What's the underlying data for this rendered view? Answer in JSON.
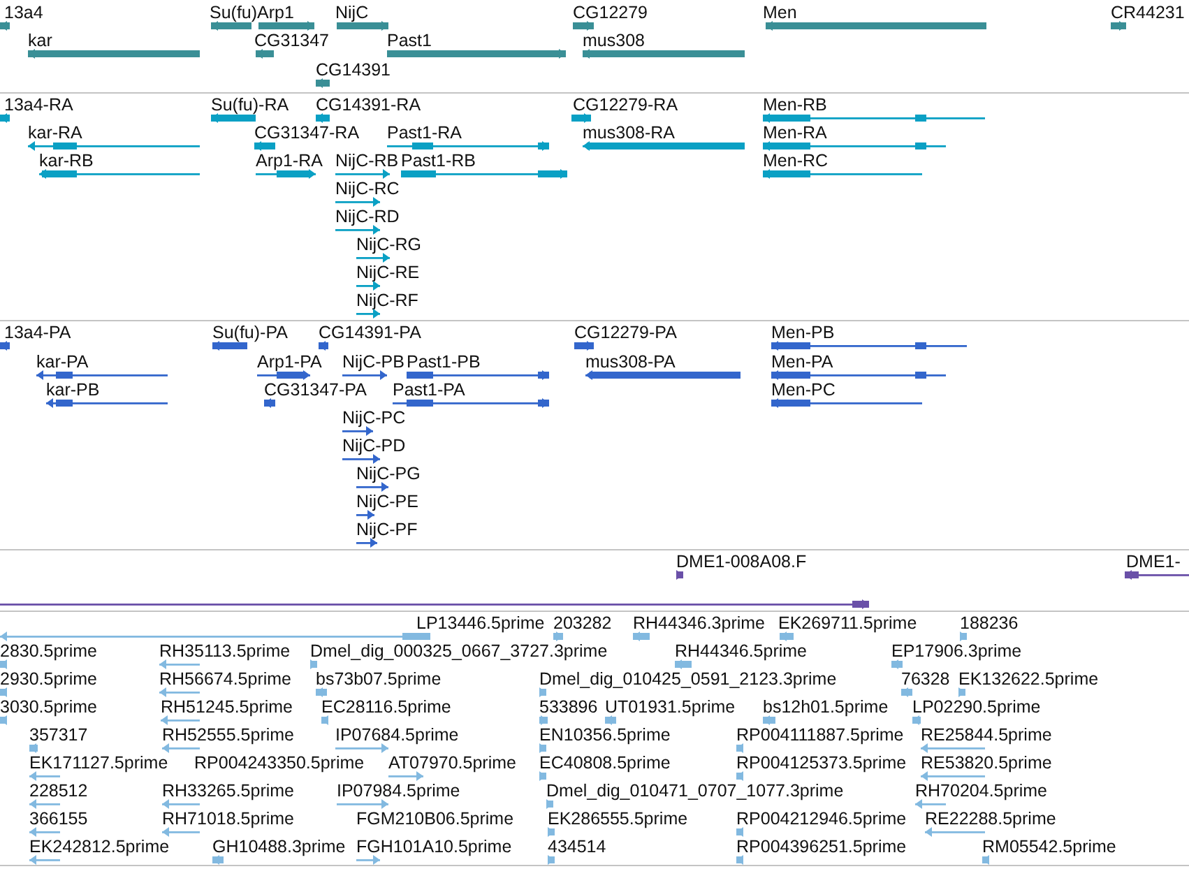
{
  "tracks": [
    {
      "kind": "gene",
      "features": [
        {
          "label": "13a4",
          "kind": "reverse"
        },
        {
          "label": "Su(fu)",
          "kind": "reverse"
        },
        {
          "label": "Arp1",
          "kind": "forward"
        },
        {
          "label": "NijC",
          "kind": "forward"
        },
        {
          "label": "CG12279",
          "kind": "forward"
        },
        {
          "label": "Men",
          "kind": "reverse"
        },
        {
          "label": "CR44231",
          "kind": "forward"
        },
        {
          "label": "kar",
          "kind": "reverse"
        },
        {
          "label": "CG31347",
          "kind": "reverse"
        },
        {
          "label": "Past1",
          "kind": "forward"
        },
        {
          "label": "mus308",
          "kind": "reverse"
        },
        {
          "label": "CG14391",
          "kind": "reverse"
        }
      ]
    },
    {
      "kind": "transcript",
      "features": [
        {
          "label": "13a4-RA",
          "kind": "reverse"
        },
        {
          "label": "Su(fu)-RA",
          "kind": "reverse"
        },
        {
          "label": "CG14391-RA",
          "kind": "reverse"
        },
        {
          "label": "CG12279-RA",
          "kind": "forward"
        },
        {
          "label": "Men-RB",
          "kind": "reverse"
        },
        {
          "label": "kar-RA",
          "kind": "reverse"
        },
        {
          "label": "CG31347-RA",
          "kind": "reverse"
        },
        {
          "label": "Past1-RA",
          "kind": "forward"
        },
        {
          "label": "mus308-RA",
          "kind": "reverse"
        },
        {
          "label": "Men-RA",
          "kind": "reverse"
        },
        {
          "label": "kar-RB",
          "kind": "reverse"
        },
        {
          "label": "Arp1-RA",
          "kind": "forward"
        },
        {
          "label": "NijC-RB",
          "kind": "forward"
        },
        {
          "label": "Past1-RB",
          "kind": "forward"
        },
        {
          "label": "Men-RC",
          "kind": "reverse"
        },
        {
          "label": "NijC-RC",
          "kind": "forward"
        },
        {
          "label": "NijC-RD",
          "kind": "forward"
        },
        {
          "label": "NijC-RG",
          "kind": "forward"
        },
        {
          "label": "NijC-RE",
          "kind": "forward"
        },
        {
          "label": "NijC-RF",
          "kind": "forward"
        }
      ]
    },
    {
      "kind": "protein",
      "features": [
        {
          "label": "13a4-PA",
          "kind": "reverse"
        },
        {
          "label": "Su(fu)-PA",
          "kind": "reverse"
        },
        {
          "label": "CG14391-PA",
          "kind": "reverse"
        },
        {
          "label": "CG12279-PA",
          "kind": "forward"
        },
        {
          "label": "Men-PB",
          "kind": "reverse"
        },
        {
          "label": "kar-PA",
          "kind": "reverse"
        },
        {
          "label": "Arp1-PA",
          "kind": "forward"
        },
        {
          "label": "NijC-PB",
          "kind": "forward"
        },
        {
          "label": "Past1-PB",
          "kind": "forward"
        },
        {
          "label": "mus308-PA",
          "kind": "reverse"
        },
        {
          "label": "Men-PA",
          "kind": "reverse"
        },
        {
          "label": "kar-PB",
          "kind": "reverse"
        },
        {
          "label": "CG31347-PA",
          "kind": "reverse"
        },
        {
          "label": "Past1-PA",
          "kind": "forward"
        },
        {
          "label": "Men-PC",
          "kind": "reverse"
        },
        {
          "label": "NijC-PC",
          "kind": "forward"
        },
        {
          "label": "NijC-PD",
          "kind": "forward"
        },
        {
          "label": "NijC-PG",
          "kind": "forward"
        },
        {
          "label": "NijC-PE",
          "kind": "forward"
        },
        {
          "label": "NijC-PF",
          "kind": "forward"
        }
      ]
    },
    {
      "kind": "clone",
      "features": [
        {
          "label": "DME1-008A08.F",
          "kind": "forward"
        },
        {
          "label": "DME1-",
          "kind": "reverse"
        },
        {
          "kind": "forward"
        }
      ]
    },
    {
      "kind": "est",
      "features": [
        {
          "label": "LP13446.5prime",
          "kind": "reverse"
        },
        {
          "label": "203282",
          "kind": "forward"
        },
        {
          "label": "RH44346.3prime",
          "kind": "reverse"
        },
        {
          "label": "EK269711.5prime",
          "kind": "reverse"
        },
        {
          "label": "188236",
          "kind": "forward"
        },
        {
          "label": "2830.5prime",
          "kind": "reverse"
        },
        {
          "label": "RH35113.5prime",
          "kind": "reverse"
        },
        {
          "label": "Dmel_dig_000325_0667_3727.3prime",
          "kind": "forward"
        },
        {
          "label": "RH44346.5prime",
          "kind": "reverse"
        },
        {
          "label": "EP17906.3prime",
          "kind": "reverse"
        },
        {
          "label": "2930.5prime",
          "kind": "reverse"
        },
        {
          "label": "RH56674.5prime",
          "kind": "reverse"
        },
        {
          "label": "bs73b07.5prime",
          "kind": "reverse"
        },
        {
          "label": "Dmel_dig_010425_0591_2123.3prime",
          "kind": "forward"
        },
        {
          "label": "76328",
          "kind": "reverse"
        },
        {
          "label": "EK132622.5prime",
          "kind": "forward"
        },
        {
          "label": "3030.5prime",
          "kind": "reverse"
        },
        {
          "label": "RH51245.5prime",
          "kind": "reverse"
        },
        {
          "label": "EC28116.5prime",
          "kind": "reverse"
        },
        {
          "label": "533896",
          "kind": "forward"
        },
        {
          "label": "UT01931.5prime",
          "kind": "reverse"
        },
        {
          "label": "bs12h01.5prime",
          "kind": "reverse"
        },
        {
          "label": "LP02290.5prime",
          "kind": "reverse"
        },
        {
          "label": "357317",
          "kind": "reverse"
        },
        {
          "label": "RH52555.5prime",
          "kind": "reverse"
        },
        {
          "label": "IP07684.5prime",
          "kind": "forward"
        },
        {
          "label": "EN10356.5prime",
          "kind": "forward"
        },
        {
          "label": "RP004111887.5prime",
          "kind": "reverse"
        },
        {
          "label": "RE25844.5prime",
          "kind": "reverse"
        },
        {
          "label": "EK171127.5prime",
          "kind": "reverse"
        },
        {
          "label": "RP004243350.5prime"
        },
        {
          "label": "AT07970.5prime",
          "kind": "forward"
        },
        {
          "label": "EC40808.5prime",
          "kind": "forward"
        },
        {
          "label": "RP004125373.5prime",
          "kind": "reverse"
        },
        {
          "label": "RE53820.5prime",
          "kind": "reverse"
        },
        {
          "label": "228512",
          "kind": "reverse"
        },
        {
          "label": "RH33265.5prime",
          "kind": "reverse"
        },
        {
          "label": "IP07984.5prime",
          "kind": "forward"
        },
        {
          "label": "Dmel_dig_010471_0707_1077.3prime",
          "kind": "forward"
        },
        {
          "label": "RH70204.5prime",
          "kind": "reverse"
        },
        {
          "label": "366155",
          "kind": "reverse"
        },
        {
          "label": "RH71018.5prime",
          "kind": "reverse"
        },
        {
          "label": "FGM210B06.5prime"
        },
        {
          "label": "EK286555.5prime",
          "kind": "forward"
        },
        {
          "label": "RP004212946.5prime",
          "kind": "reverse"
        },
        {
          "label": "RE22288.5prime",
          "kind": "reverse"
        },
        {
          "label": "EK242812.5prime",
          "kind": "reverse"
        },
        {
          "label": "GH10488.3prime",
          "kind": "reverse"
        },
        {
          "label": "FGH101A10.5prime",
          "kind": "forward"
        },
        {
          "label": "434514",
          "kind": "forward"
        },
        {
          "label": "RP004396251.5prime",
          "kind": "reverse"
        },
        {
          "label": "RM05542.5prime",
          "kind": "reverse"
        }
      ]
    }
  ]
}
